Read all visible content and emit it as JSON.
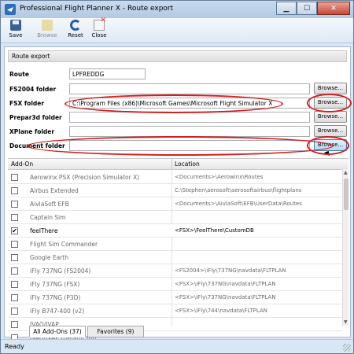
{
  "window": {
    "title": "Professional Flight Planner X - Route export",
    "controls": [
      "minimize",
      "maximize",
      "close"
    ]
  },
  "toolbar": {
    "save_label": "Save",
    "browse_label": "Browse",
    "reset_label": "Reset",
    "close_label": "Close"
  },
  "section": {
    "title": "Route export"
  },
  "fields": {
    "route": {
      "label": "Route",
      "value": "LPFREDDG"
    },
    "fs2004": {
      "label": "FS2004 folder",
      "value": "",
      "button": "Browse..."
    },
    "fsx": {
      "label": "FSX folder",
      "value": "C:\\Program Files (x86)\\Microsoft Games\\Microsoft Flight Simulator X",
      "button": "Browse..."
    },
    "prepar3d": {
      "label": "Prepar3d folder",
      "value": "",
      "button": "Browse..."
    },
    "xplane": {
      "label": "XPlane folder",
      "value": "",
      "button": "Browse..."
    },
    "document": {
      "label": "Document folder",
      "value": "",
      "button": "Browse..."
    }
  },
  "grid": {
    "columns": [
      "Add-On",
      "Location"
    ],
    "rows": [
      {
        "name": "Aerowinx PSX (Precision Simulator X)",
        "location": "<Documents>\\Aerowinx\\Routes",
        "checked": false
      },
      {
        "name": "Airbus Extended",
        "location": "C:\\Stephen\\aerosoft\\aerosoftairbus\\flightplans",
        "checked": false
      },
      {
        "name": "AivlaSoft EFB",
        "location": "<Documents>\\AivlaSoft\\EFB\\UserData\\Routes",
        "checked": false
      },
      {
        "name": "Captain Sim",
        "location": "",
        "checked": false
      },
      {
        "name": "feelThere",
        "location": "<FSX>\\FeelThere\\CustomDB",
        "checked": true
      },
      {
        "name": "Flight Sim Commander",
        "location": "",
        "checked": false
      },
      {
        "name": "Google Earth",
        "location": "",
        "checked": false
      },
      {
        "name": "iFly 737NG (FS2004)",
        "location": "<FS2004>\\iFly\\737NG\\navdata\\FLTPLAN",
        "checked": false
      },
      {
        "name": "iFly 737NG (FSX)",
        "location": "<FSX>\\iFly\\737NG\\navdata\\FLTPLAN",
        "checked": false
      },
      {
        "name": "iFly 737NG (P3D)",
        "location": "<FSX>\\iFly\\737NG\\navdata\\FLTPLAN",
        "checked": false
      },
      {
        "name": "iFly B747-400 (v2)",
        "location": "<FSX>\\iFly\\744\\navdata\\FLTPLAN",
        "checked": false
      },
      {
        "name": "IVAO/IVAP",
        "location": "",
        "checked": false
      },
      {
        "name": "IVAO/IVAP (Default.fpl)",
        "location": "",
        "checked": false
      }
    ]
  },
  "tabs": [
    {
      "label": "All Add-Ons (37)",
      "active": true
    },
    {
      "label": "Favorites (9)",
      "active": false
    }
  ],
  "status": {
    "text": "Ready"
  },
  "check_glyph": "✔",
  "icons": [
    "app-icon",
    "save-icon",
    "browse-icon",
    "reset-icon",
    "close-icon"
  ]
}
